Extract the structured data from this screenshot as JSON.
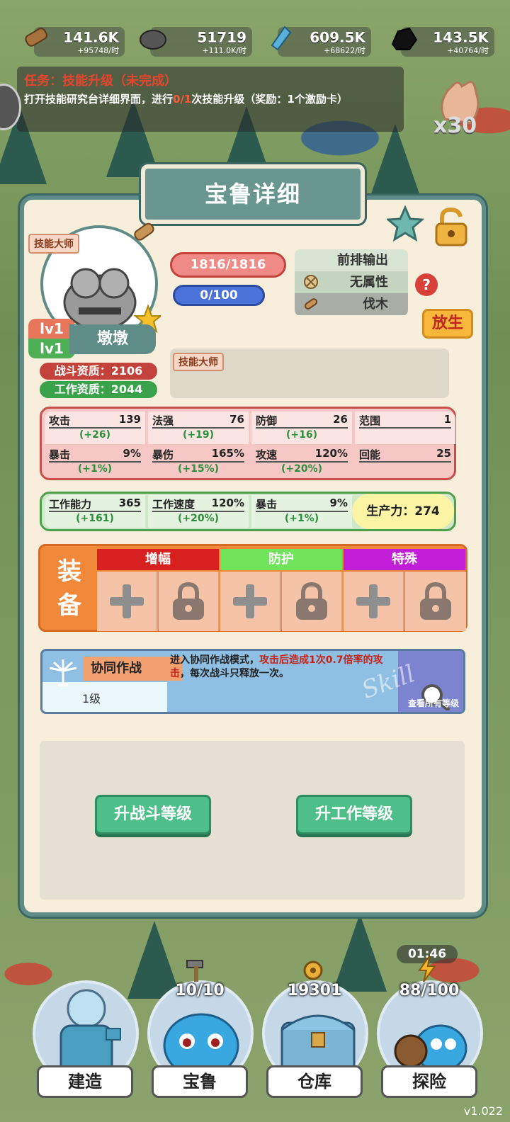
{
  "resources": [
    {
      "name": "wood",
      "icon": "log-icon",
      "value": "141.6K",
      "rate": "+95748/时"
    },
    {
      "name": "stone",
      "icon": "rock-icon",
      "value": "51719",
      "rate": "+111.0K/时"
    },
    {
      "name": "crystal",
      "icon": "crystal-icon",
      "value": "609.5K",
      "rate": "+68622/时"
    },
    {
      "name": "coal",
      "icon": "coal-icon",
      "value": "143.5K",
      "rate": "+40764/时"
    }
  ],
  "task": {
    "title": "任务：技能升级（未完成）",
    "desc_pre": "打开技能研究台详细界面，进行",
    "progress": "0/1",
    "desc_post": "次技能升级（奖励：1个激励卡）"
  },
  "hand_count": "x30",
  "panel": {
    "title": "宝鲁详细",
    "trait_tag": "技能大师",
    "level_battle": "lv1",
    "level_work": "lv1",
    "name": "墩墩",
    "battle_quality": "战斗资质：2106",
    "work_quality": "工作资质：2044",
    "hp": "1816/1816",
    "mp": "0/100",
    "roles": [
      "前排输出",
      "无属性",
      "伐木"
    ],
    "help": "?",
    "release": "放生",
    "skill_tag": "技能大师"
  },
  "stats": [
    {
      "k": "攻击",
      "n": "139",
      "d": "(+26)"
    },
    {
      "k": "法强",
      "n": "76",
      "d": "(+19)"
    },
    {
      "k": "防御",
      "n": "26",
      "d": "(+16)"
    },
    {
      "k": "范围",
      "n": "1",
      "d": ""
    },
    {
      "k": "暴击",
      "n": "9%",
      "d": "(+1%)"
    },
    {
      "k": "暴伤",
      "n": "165%",
      "d": "(+15%)"
    },
    {
      "k": "攻速",
      "n": "120%",
      "d": "(+20%)"
    },
    {
      "k": "回能",
      "n": "25",
      "d": ""
    }
  ],
  "work": [
    {
      "k": "工作能力",
      "n": "365",
      "d": "(+161)"
    },
    {
      "k": "工作速度",
      "n": "120%",
      "d": "(+20%)"
    },
    {
      "k": "暴击",
      "n": "9%",
      "d": "(+1%)"
    }
  ],
  "productivity": "生产力：274",
  "equip": {
    "label": "装备",
    "headers": [
      "增幅",
      "防护",
      "特殊"
    ],
    "header_colors": [
      "#d8201e",
      "#6fe35a",
      "#c21ed8"
    ]
  },
  "skill": {
    "name": "协同作战",
    "level": "1级",
    "desc_pre": "进入协同作战模式，",
    "desc_em": "攻击后造成1次0.7倍率的攻击",
    "desc_post": "，每次战斗只释放一次。",
    "view_all": "查看所有等级",
    "watermark": "Skill"
  },
  "buttons": {
    "battle": "升战斗等级",
    "work": "升工作等级"
  },
  "nav": [
    {
      "label": "建造",
      "count": ""
    },
    {
      "label": "宝鲁",
      "count": "10/10"
    },
    {
      "label": "仓库",
      "count": "19301"
    },
    {
      "label": "探险",
      "count": "88/100"
    }
  ],
  "timer": "01:46",
  "version": "v1.022"
}
